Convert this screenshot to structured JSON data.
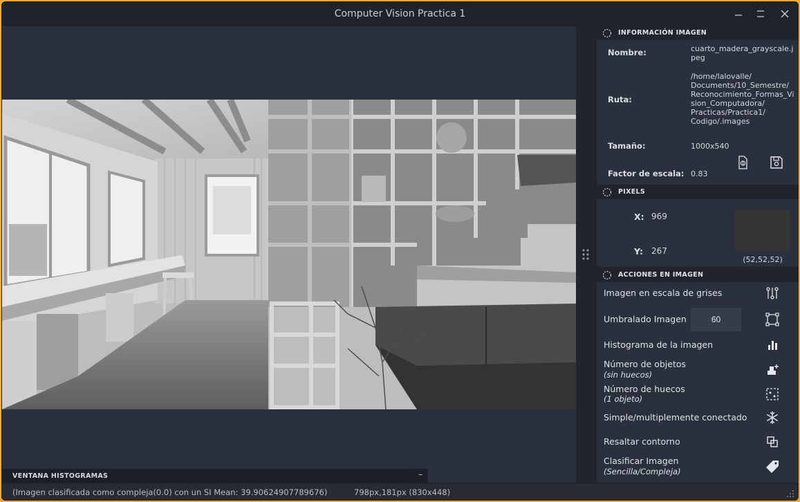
{
  "window": {
    "title": "Computer Vision Practica 1"
  },
  "info": {
    "header": "INFORMACIÓN IMAGEN",
    "nombre_label": "Nombre:",
    "nombre_lines": [
      "cuarto_madera_grayscale.j",
      "peg"
    ],
    "ruta_label": "Ruta:",
    "ruta_lines": [
      "/home/lalovalle/",
      "Documents/10_Semestre/",
      "Reconocimiento_Formas_Vi",
      "sion_Computadora/",
      "Practicas/Practica1/",
      "Codigo/.images"
    ],
    "tamano_label": "Tamaño:",
    "tamano_value": "1000x540",
    "factor_label": "Factor de escala:",
    "factor_value": "0.83"
  },
  "pixels": {
    "header": "PIXELS",
    "x_label": "X:",
    "x_value": "969",
    "y_label": "Y:",
    "y_value": "267",
    "rgb_text": "(52,52,52)",
    "swatch_color": "#343434"
  },
  "actions": {
    "header": "ACCIONES EN IMAGEN",
    "grayscale": "Imagen en escala de grises",
    "threshold": "Umbralado Imagen",
    "threshold_value": "60",
    "histogram": "Histograma de la imagen",
    "objects": "Número de objetos",
    "objects_sub": "(sin huecos)",
    "holes": "Número de huecos",
    "holes_sub": "(1 objeto)",
    "connected": "Simple/multiplemente conectado",
    "contour": "Resaltar contorno",
    "classify": "Clasificar Imagen",
    "classify_sub": "(Sencilla/Compleja)"
  },
  "histograms": {
    "title": "VENTANA HISTOGRAMAS",
    "minimize": "–"
  },
  "status": {
    "message": "(Imagen clasificada como compleja(0.0) con un SI Mean: 39.90624907789676)",
    "dimensions": "798px,181px (830x448)"
  },
  "icons": [
    "minimize-icon",
    "maximize-icon",
    "close-icon",
    "scan-icon",
    "save-icon",
    "dashed-circle-icon",
    "grayscale-icon",
    "threshold-icon",
    "bar-chart-icon",
    "objects-icon",
    "holes-icon",
    "snowflake-icon",
    "contour-icon",
    "tag-icon"
  ]
}
